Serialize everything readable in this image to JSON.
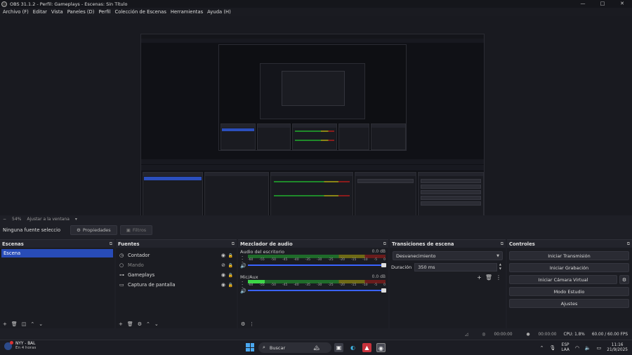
{
  "window": {
    "title": "OBS 31.1.2 - Perfil: Gameplays - Escenas: Sin Título",
    "minimize": "—",
    "maximize": "□",
    "close": "✕"
  },
  "menu": [
    "Archivo (F)",
    "Editar",
    "Vista",
    "Paneles (D)",
    "Perfil",
    "Colección de Escenas",
    "Herramientas",
    "Ayuda (H)"
  ],
  "zoom": {
    "minus": "−",
    "value": "54%",
    "fit": "Ajustar a la ventana",
    "dropdown": "▾"
  },
  "source_bar": {
    "no_source": "Ninguna fuente seleccionada",
    "properties": "Propiedades",
    "filters": "Filtros"
  },
  "scenes": {
    "title": "Escenas",
    "items": [
      "Escena"
    ]
  },
  "sources": {
    "title": "Fuentes",
    "items": [
      {
        "icon": "clock-icon",
        "glyph": "◷",
        "label": "Contador",
        "visible": true
      },
      {
        "icon": "circle-icon",
        "glyph": "○",
        "label": "Mando",
        "visible": false
      },
      {
        "icon": "gamepad-icon",
        "glyph": "⊶",
        "label": "Gameplays",
        "visible": true
      },
      {
        "icon": "monitor-icon",
        "glyph": "▭",
        "label": "Captura de pantalla",
        "visible": true
      }
    ]
  },
  "mixer": {
    "title": "Mezclador de audio",
    "channels": [
      {
        "name": "Audio del escritorio",
        "db": "0.0 dB",
        "level": 0.0,
        "volume": 1.0
      },
      {
        "name": "Mic/Aux",
        "db": "0.0 dB",
        "level": 0.12,
        "volume": 1.0
      }
    ],
    "ticks": [
      "-60",
      "-55",
      "-50",
      "-45",
      "-40",
      "-35",
      "-30",
      "-25",
      "-20",
      "-15",
      "-10",
      "-5",
      "0"
    ]
  },
  "transitions": {
    "title": "Transiciones de escena",
    "selected": "Desvanecimiento",
    "duration_label": "Duración",
    "duration_value": "350 ms"
  },
  "controls": {
    "title": "Controles",
    "start_stream": "Iniciar Transmisión",
    "start_recording": "Iniciar Grabación",
    "start_vcam": "Iniciar Cámara Virtual",
    "studio_mode": "Modo Estudio",
    "settings": "Ajustes"
  },
  "status": {
    "stream_time": "00:00:00",
    "rec_time": "00:00:00",
    "cpu": "CPU: 1.8%",
    "fps": "60.00 / 60.00 FPS"
  },
  "taskbar": {
    "weather_line1": "NYY - BAL",
    "weather_line2": "En 4 horas",
    "search": "Buscar",
    "lang1": "ESP",
    "lang2": "LAA",
    "time": "11:16",
    "date": "21/9/2025"
  },
  "colors": {
    "accent_blue": "#284cb8",
    "meter_green": "#3bd646",
    "volume_blue": "#3a63ff"
  }
}
